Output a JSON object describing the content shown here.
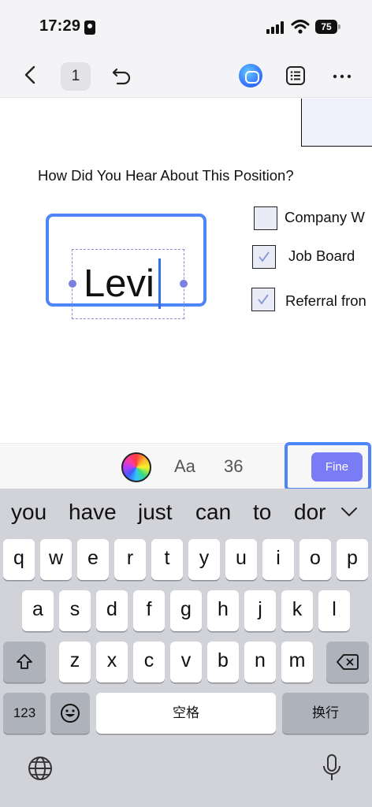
{
  "status_bar": {
    "time": "17:29",
    "battery": "75"
  },
  "toolbar": {
    "page_number": "1"
  },
  "document": {
    "question": "How Did You Hear About This Position?",
    "options": [
      {
        "label": "Company W",
        "checked": false
      },
      {
        "label": "Job Board",
        "checked": true
      },
      {
        "label": "Referral fron",
        "checked": true
      }
    ],
    "signature_text": "Levi"
  },
  "format_bar": {
    "aa_label": "Aa",
    "font_size": "36",
    "done_label": "Fine"
  },
  "keyboard": {
    "suggestions": [
      "you",
      "have",
      "just",
      "can",
      "to",
      "dor"
    ],
    "row1": [
      "q",
      "w",
      "e",
      "r",
      "t",
      "y",
      "u",
      "i",
      "o",
      "p"
    ],
    "row2": [
      "a",
      "s",
      "d",
      "f",
      "g",
      "h",
      "j",
      "k",
      "l"
    ],
    "row3": [
      "z",
      "x",
      "c",
      "v",
      "b",
      "n",
      "m"
    ],
    "numbers_key": "123",
    "space_key": "空格",
    "return_key": "换行"
  },
  "colors": {
    "accent_blue": "#4f86f7",
    "done_button": "#7a7cf5",
    "caret": "#2f6ff0"
  },
  "icons": [
    "back-chevron-icon",
    "undo-icon",
    "ai-assistant-icon",
    "outline-list-icon",
    "more-dots-icon",
    "color-picker-icon",
    "shift-icon",
    "delete-icon",
    "emoji-icon",
    "globe-icon",
    "microphone-icon",
    "chevron-down-icon"
  ]
}
